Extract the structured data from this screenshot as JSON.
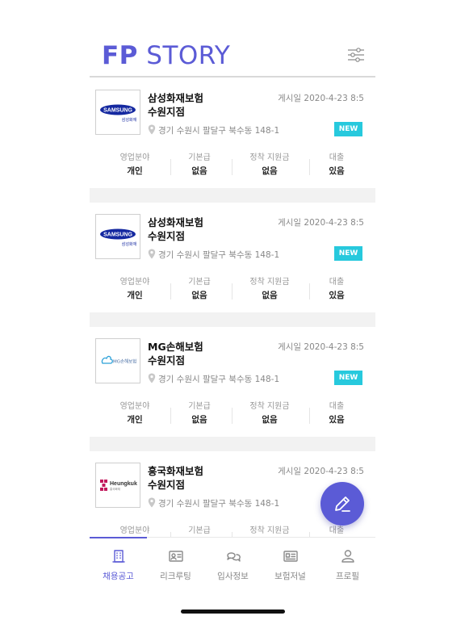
{
  "app": {
    "logo_bold": "FP",
    "logo_rest": "STORY"
  },
  "colors": {
    "accent": "#5b5bd6",
    "badge": "#27c9dd",
    "separator": "#f2f2f2"
  },
  "icons": {
    "filter": "sliders-icon",
    "location": "map-pin-icon",
    "fab": "pencil-icon"
  },
  "stat_labels": [
    "영업분야",
    "기본급",
    "정착 지원금",
    "대출"
  ],
  "posts": [
    {
      "logo": "samsung",
      "logo_text": "SAMSUNG",
      "logo_sub": "삼성화재",
      "company": "삼성화재보험",
      "branch": "수원지점",
      "date": "게시일 2020-4-23 8:5",
      "address": "경기 수원시 팔달구 북수동 148-1",
      "badge": "NEW",
      "values": [
        "개인",
        "없음",
        "없음",
        "있음"
      ]
    },
    {
      "logo": "samsung",
      "logo_text": "SAMSUNG",
      "logo_sub": "삼성화재",
      "company": "삼성화재보험",
      "branch": "수원지점",
      "date": "게시일 2020-4-23 8:5",
      "address": "경기 수원시 팔달구 북수동 148-1",
      "badge": "NEW",
      "values": [
        "개인",
        "없음",
        "없음",
        "있음"
      ]
    },
    {
      "logo": "mg",
      "logo_text": "MG손해보험",
      "logo_sub": "",
      "company": "MG손해보험",
      "branch": "수원지점",
      "date": "게시일 2020-4-23 8:5",
      "address": "경기 수원시 팔달구 북수동 148-1",
      "badge": "NEW",
      "values": [
        "개인",
        "없음",
        "없음",
        "있음"
      ]
    },
    {
      "logo": "heungkuk",
      "logo_text": "Heungkuk",
      "logo_sub": "흥국화재",
      "company": "흥국화재보험",
      "branch": "수원지점",
      "date": "게시일 2020-4-23 8:5",
      "address": "경기 수원시 팔달구 북수동 148-1",
      "badge": "",
      "values": [
        "",
        "",
        "",
        ""
      ]
    }
  ],
  "tabs": [
    {
      "label": "채용공고",
      "icon": "building-icon",
      "active": true
    },
    {
      "label": "리크루팅",
      "icon": "id-card-icon",
      "active": false
    },
    {
      "label": "입사정보",
      "icon": "chat-bubbles-icon",
      "active": false
    },
    {
      "label": "보험저널",
      "icon": "newspaper-icon",
      "active": false
    },
    {
      "label": "프로필",
      "icon": "user-icon",
      "active": false
    }
  ]
}
